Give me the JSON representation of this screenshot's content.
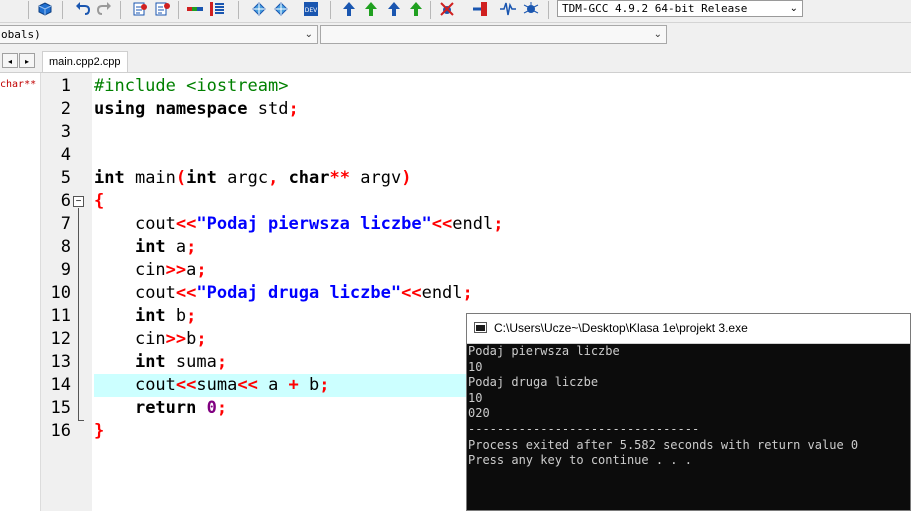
{
  "toolbar": {
    "compiler": "TDM-GCC 4.9.2 64-bit Release",
    "icons": [
      "new-project-icon",
      "undo-icon",
      "redo-icon",
      "class-find-icon",
      "class-list-icon",
      "color-bar-icon",
      "list-icon",
      "compile-icon",
      "run-icon",
      "devpp-icon",
      "up-arrow-icon",
      "up-arrow-icon",
      "up-arrow-icon",
      "up-arrow-icon",
      "debug-icon",
      "add-watch-icon",
      "wave-icon",
      "bug-icon"
    ]
  },
  "scope": {
    "left_value": "obals)",
    "right_value": ""
  },
  "tabs": {
    "nav_left": "◂",
    "nav_right": "▸",
    "active": "main.cpp2.cpp"
  },
  "class_browser": {
    "item": "char**"
  },
  "editor": {
    "highlighted_line": 14,
    "lines": [
      {
        "n": "1"
      },
      {
        "n": "2"
      },
      {
        "n": "3"
      },
      {
        "n": "4"
      },
      {
        "n": "5"
      },
      {
        "n": "6"
      },
      {
        "n": "7"
      },
      {
        "n": "8"
      },
      {
        "n": "9"
      },
      {
        "n": "10"
      },
      {
        "n": "11"
      },
      {
        "n": "12"
      },
      {
        "n": "13"
      },
      {
        "n": "14"
      },
      {
        "n": "15"
      },
      {
        "n": "16"
      }
    ],
    "tokens": {
      "l1": {
        "pp": "#include <iostream>"
      },
      "l2": {
        "a": "using namespace",
        "b": " std",
        "c": ";"
      },
      "l5": {
        "a": "int",
        "b": " main",
        "c": "(",
        "d": "int",
        "e": " argc",
        ",": ",",
        "f": " ",
        "g": "char",
        "h": "**",
        "i": " argv",
        ")": ")"
      },
      "l6": {
        "brace": "{"
      },
      "l7": {
        "indent": "    ",
        "a": "cout",
        "b": "<<",
        "c": "\"Podaj pierwsza liczbe\"",
        "d": "<<",
        "e": "endl",
        "f": ";"
      },
      "l8": {
        "indent": "    ",
        "a": "int",
        "b": " a",
        "c": ";"
      },
      "l9": {
        "indent": "    ",
        "a": "cin",
        "b": ">>",
        "c": "a",
        "d": ";"
      },
      "l10": {
        "indent": "    ",
        "a": "cout",
        "b": "<<",
        "c": "\"Podaj druga liczbe\"",
        "d": "<<",
        "e": "endl",
        "f": ";"
      },
      "l11": {
        "indent": "    ",
        "a": "int",
        "b": " b",
        "c": ";"
      },
      "l12": {
        "indent": "    ",
        "a": "cin",
        "b": ">>",
        "c": "b",
        "d": ";"
      },
      "l13": {
        "indent": "    ",
        "a": "int",
        "b": " suma",
        "c": ";"
      },
      "l14": {
        "indent": "    ",
        "a": "cout",
        "b": "<<",
        "c": "suma",
        "d": "<<",
        "e": " a ",
        "f": "+",
        "g": " b",
        "h": ";"
      },
      "l15": {
        "indent": "    ",
        "a": "return",
        "b": " ",
        "c": "0",
        "d": ";"
      },
      "l16": {
        "brace": "}"
      }
    }
  },
  "console": {
    "title": "C:\\Users\\Ucze~\\Desktop\\Klasa 1e\\projekt 3.exe",
    "lines": [
      "Podaj pierwsza liczbe",
      "10",
      "Podaj druga liczbe",
      "10",
      "020",
      "--------------------------------",
      "Process exited after 5.582 seconds with return value 0",
      "Press any key to continue . . ."
    ]
  }
}
